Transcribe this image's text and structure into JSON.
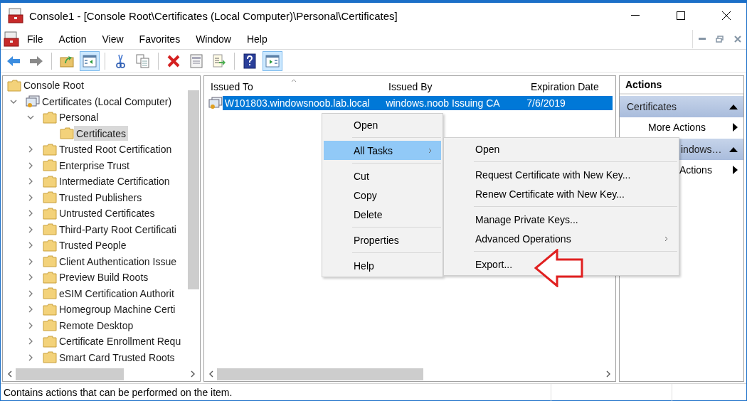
{
  "window": {
    "title": "Console1 - [Console Root\\Certificates (Local Computer)\\Personal\\Certificates]"
  },
  "menu_bar": [
    "File",
    "Action",
    "View",
    "Favorites",
    "Window",
    "Help"
  ],
  "toolbar": [
    {
      "kind": "back",
      "pressed": false
    },
    {
      "kind": "forward",
      "pressed": false
    },
    {
      "kind": "separator"
    },
    {
      "kind": "up",
      "pressed": false
    },
    {
      "kind": "tree",
      "pressed": true
    },
    {
      "kind": "separator"
    },
    {
      "kind": "cut",
      "pressed": false
    },
    {
      "kind": "copy",
      "pressed": false
    },
    {
      "kind": "separator"
    },
    {
      "kind": "delete",
      "pressed": false
    },
    {
      "kind": "properties",
      "pressed": false
    },
    {
      "kind": "export",
      "pressed": false
    },
    {
      "kind": "separator"
    },
    {
      "kind": "help",
      "pressed": false
    },
    {
      "kind": "actionpane",
      "pressed": true
    }
  ],
  "tree": [
    {
      "label": "Console Root",
      "kind": "folder",
      "selected": false,
      "children": [
        {
          "label": "Certificates (Local Computer)",
          "kind": "certs",
          "expanded": true,
          "selected": false,
          "children": [
            {
              "label": "Personal",
              "kind": "folder",
              "expanded": true,
              "selected": false,
              "children": [
                {
                  "label": "Certificates",
                  "kind": "folder",
                  "selected": true
                }
              ]
            },
            {
              "label": "Trusted Root Certification",
              "kind": "folder",
              "expanded": false,
              "selected": false
            },
            {
              "label": "Enterprise Trust",
              "kind": "folder",
              "expanded": false,
              "selected": false
            },
            {
              "label": "Intermediate Certification",
              "kind": "folder",
              "expanded": false,
              "selected": false
            },
            {
              "label": "Trusted Publishers",
              "kind": "folder",
              "expanded": false,
              "selected": false
            },
            {
              "label": "Untrusted Certificates",
              "kind": "folder",
              "expanded": false,
              "selected": false
            },
            {
              "label": "Third-Party Root Certificati",
              "kind": "folder",
              "expanded": false,
              "selected": false
            },
            {
              "label": "Trusted People",
              "kind": "folder",
              "expanded": false,
              "selected": false
            },
            {
              "label": "Client Authentication Issue",
              "kind": "folder",
              "expanded": false,
              "selected": false
            },
            {
              "label": "Preview Build Roots",
              "kind": "folder",
              "expanded": false,
              "selected": false
            },
            {
              "label": "eSIM Certification Authorit",
              "kind": "folder",
              "expanded": false,
              "selected": false
            },
            {
              "label": "Homegroup Machine Certi",
              "kind": "folder",
              "expanded": false,
              "selected": false
            },
            {
              "label": "Remote Desktop",
              "kind": "folder",
              "expanded": false,
              "selected": false
            },
            {
              "label": "Certificate Enrollment Requ",
              "kind": "folder",
              "expanded": false,
              "selected": false
            },
            {
              "label": "Smart Card Trusted Roots",
              "kind": "folder",
              "expanded": false,
              "selected": false
            }
          ]
        }
      ]
    }
  ],
  "table": {
    "columns": [
      "Issued To",
      "Issued By",
      "Expiration Date"
    ],
    "rows": [
      {
        "cells": [
          "W101803.windowsnoob.lab.local",
          "windows.noob Issuing CA",
          "7/6/2019"
        ],
        "selected": true
      }
    ]
  },
  "actions": {
    "title": "Actions",
    "sections": [
      {
        "header": "Certificates",
        "items": [
          "More Actions"
        ]
      },
      {
        "header": "indows…",
        "items": [
          "Actions"
        ]
      }
    ]
  },
  "context_menu": [
    {
      "kind": "item",
      "label": "Open",
      "selected": false,
      "submenu": false
    },
    {
      "kind": "separator"
    },
    {
      "kind": "item",
      "label": "All Tasks",
      "selected": true,
      "submenu": true
    },
    {
      "kind": "separator"
    },
    {
      "kind": "item",
      "label": "Cut",
      "selected": false,
      "submenu": false
    },
    {
      "kind": "item",
      "label": "Copy",
      "selected": false,
      "submenu": false
    },
    {
      "kind": "item",
      "label": "Delete",
      "selected": false,
      "submenu": false
    },
    {
      "kind": "separator"
    },
    {
      "kind": "item",
      "label": "Properties",
      "selected": false,
      "submenu": false
    },
    {
      "kind": "separator"
    },
    {
      "kind": "item",
      "label": "Help",
      "selected": false,
      "submenu": false
    }
  ],
  "submenu": [
    {
      "kind": "item",
      "label": "Open",
      "selected": false,
      "submenu": false
    },
    {
      "kind": "separator"
    },
    {
      "kind": "item",
      "label": "Request Certificate with New Key...",
      "selected": false,
      "submenu": false
    },
    {
      "kind": "item",
      "label": "Renew Certificate with New Key...",
      "selected": false,
      "submenu": false
    },
    {
      "kind": "separator"
    },
    {
      "kind": "item",
      "label": "Manage Private Keys...",
      "selected": false,
      "submenu": false
    },
    {
      "kind": "item",
      "label": "Advanced Operations",
      "selected": false,
      "submenu": true
    },
    {
      "kind": "separator"
    },
    {
      "kind": "item",
      "label": "Export...",
      "selected": false,
      "submenu": false
    }
  ],
  "status_bar": {
    "text": "Contains actions that can be performed on the item."
  }
}
